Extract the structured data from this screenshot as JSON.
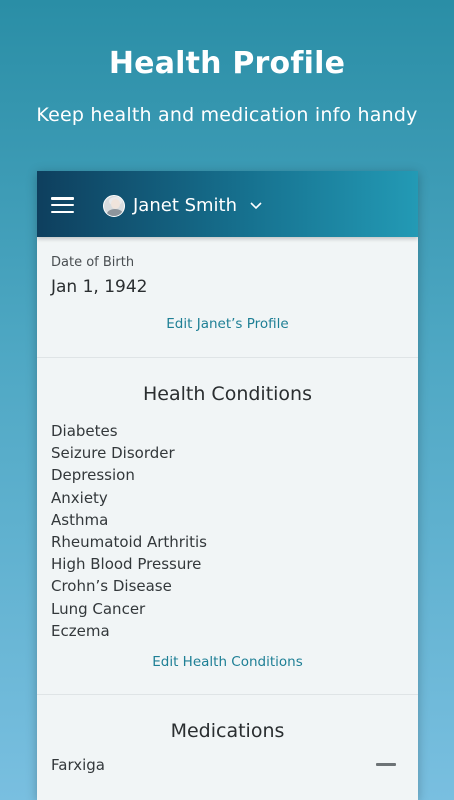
{
  "promo": {
    "title": "Health Profile",
    "subtitle": "Keep health and medication info handy"
  },
  "appbar": {
    "menu_icon": "hamburger-menu-icon",
    "profile_name": "Janet Smith",
    "chevron_icon": "chevron-down-icon"
  },
  "profile": {
    "dob_label": "Date of Birth",
    "dob_value": "Jan 1, 1942",
    "edit_link": "Edit Janet’s Profile"
  },
  "conditions": {
    "heading": "Health Conditions",
    "items": [
      "Diabetes",
      "Seizure Disorder",
      "Depression",
      "Anxiety",
      "Asthma",
      "Rheumatoid Arthritis",
      "High Blood Pressure",
      "Crohn’s Disease",
      "Lung Cancer",
      "Eczema"
    ],
    "edit_link": "Edit Health Conditions"
  },
  "medications": {
    "heading": "Medications",
    "items": [
      "Farxiga"
    ]
  },
  "colors": {
    "accent": "#1e7f95",
    "appbar_start": "#0e3f5e",
    "appbar_end": "#239ab5"
  }
}
